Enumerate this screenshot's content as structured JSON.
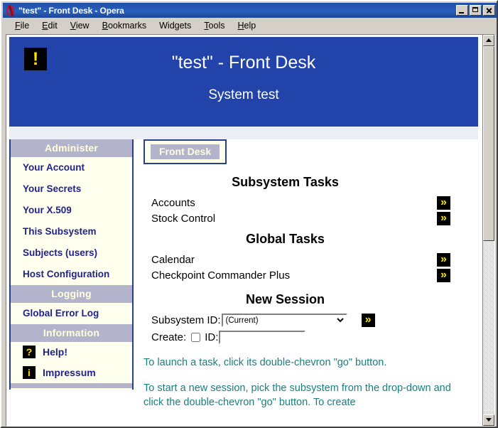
{
  "window": {
    "title": "\"test\" - Front Desk - Opera",
    "logo_icon": "opera-logo-icon",
    "buttons": {
      "minimize": "minimize-button",
      "maximize": "maximize-button",
      "close": "close-button"
    }
  },
  "menubar": {
    "items": [
      {
        "label": "File",
        "accel": "F"
      },
      {
        "label": "Edit",
        "accel": "E"
      },
      {
        "label": "View",
        "accel": "V"
      },
      {
        "label": "Bookmarks",
        "accel": "B"
      },
      {
        "label": "Widgets",
        "accel": "g"
      },
      {
        "label": "Tools",
        "accel": "T"
      },
      {
        "label": "Help",
        "accel": "H"
      }
    ]
  },
  "banner": {
    "icon": "exclamation-icon",
    "icon_glyph": "!",
    "title": "\"test\" - Front Desk",
    "subtitle": "System test",
    "bg_color": "#2244aa",
    "text_color": "#ffffff"
  },
  "sidebar": {
    "bg_color": "#ffffee",
    "header_bg_color": "#b3b3cc",
    "header_text_color": "#ffffdd",
    "link_color": "#22228c",
    "sections": [
      {
        "header": "Administer",
        "links": [
          {
            "label": "Your Account"
          },
          {
            "label": "Your Secrets"
          },
          {
            "label": "Your X.509"
          },
          {
            "label": "This Subsystem"
          },
          {
            "label": "Subjects (users)"
          },
          {
            "label": "Host Configuration"
          }
        ]
      },
      {
        "header": "Logging",
        "links": [
          {
            "label": "Global Error Log"
          }
        ]
      },
      {
        "header": "Information",
        "links": [
          {
            "label": "Help!",
            "icon": "question-mark-icon",
            "glyph": "?"
          },
          {
            "label": "Impressum",
            "icon": "info-icon",
            "glyph": "i"
          }
        ]
      }
    ]
  },
  "tabs": [
    {
      "label": "Front Desk",
      "selected": true
    }
  ],
  "main": {
    "sections": [
      {
        "title": "Subsystem Tasks",
        "tasks": [
          {
            "label": "Accounts",
            "go": "»"
          },
          {
            "label": "Stock Control",
            "go": "»"
          }
        ]
      },
      {
        "title": "Global Tasks",
        "tasks": [
          {
            "label": "Calendar",
            "go": "»"
          },
          {
            "label": "Checkpoint Commander Plus",
            "go": "»"
          }
        ]
      }
    ],
    "new_session": {
      "title": "New Session",
      "subsystem_label": "Subsystem ID:",
      "subsystem_value": "(Current)",
      "subsystem_options": [
        "(Current)"
      ],
      "go_label": "»",
      "create_label": "Create:",
      "create_checked": false,
      "id_label": "ID:",
      "id_value": "",
      "id_placeholder": ""
    },
    "help_color": "#1a7f7f",
    "help_paragraphs": [
      "To launch a task, click its double-chevron \"go\" button.",
      "To start a new session, pick the subsystem from the drop-down and click the double-chevron \"go\" button. To create"
    ]
  },
  "scrollbar": {
    "up_arrow": "scroll-up-arrow",
    "down_arrow": "scroll-down-arrow",
    "thumb": "scroll-thumb"
  }
}
